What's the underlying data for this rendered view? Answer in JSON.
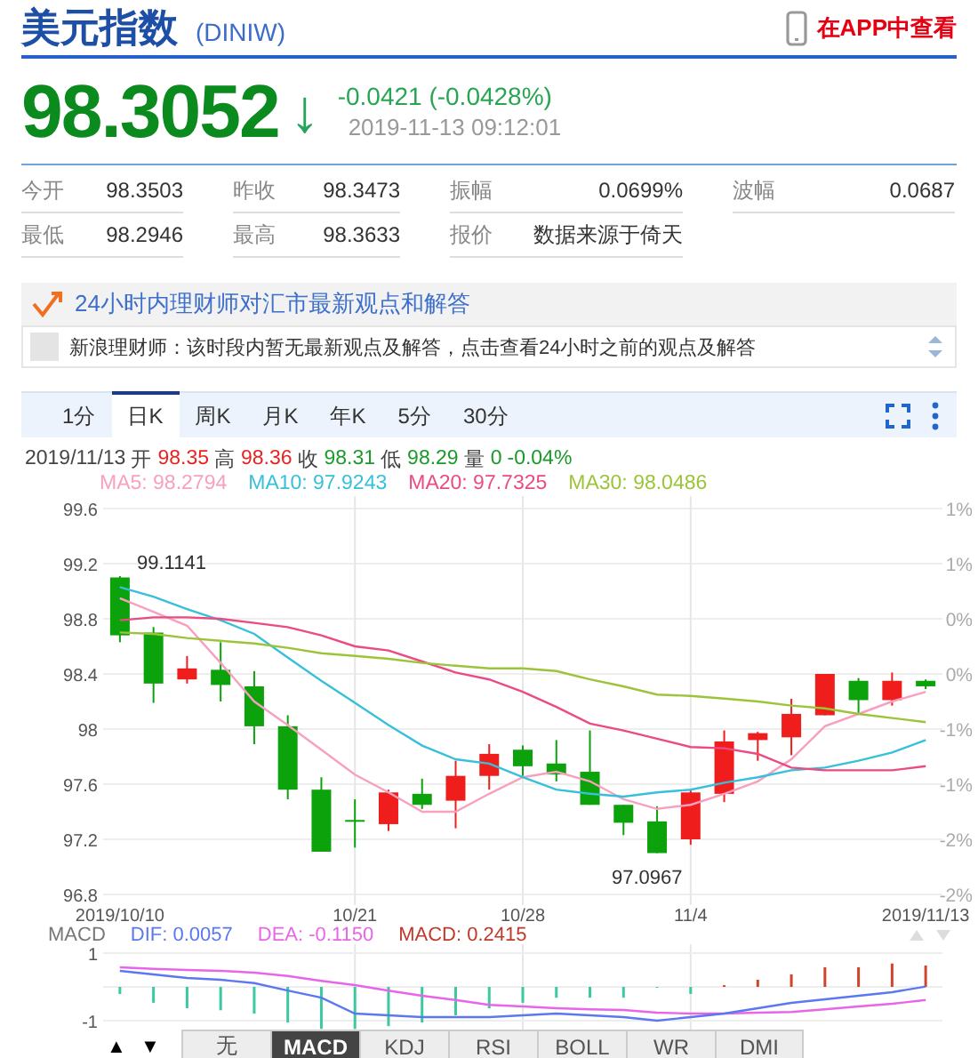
{
  "header": {
    "title": "美元指数",
    "code": "(DINIW)",
    "app_link": "在APP中查看"
  },
  "quote": {
    "price": "98.3052",
    "arrow": "↓",
    "change": "-0.0421 (-0.0428%)",
    "time": "2019-11-13 09:12:01"
  },
  "stats": [
    [
      {
        "label": "今开",
        "value": "98.3503"
      },
      {
        "label": "昨收",
        "value": "98.3473"
      },
      {
        "label": "振幅",
        "value": "0.0699%"
      },
      {
        "label": "波幅",
        "value": "0.0687"
      }
    ],
    [
      {
        "label": "最低",
        "value": "98.2946"
      },
      {
        "label": "最高",
        "value": "98.3633"
      },
      {
        "label": "报价",
        "value": "数据来源于倚天"
      }
    ]
  ],
  "expert": {
    "title": "24小时内理财师对汇市最新观点和解答",
    "message": "新浪理财师：该时段内暂无最新观点及解答，点击查看24小时之前的观点及解答"
  },
  "period_tabs": [
    {
      "label": "1分",
      "selected": false
    },
    {
      "label": "日K",
      "selected": true
    },
    {
      "label": "周K",
      "selected": false
    },
    {
      "label": "月K",
      "selected": false
    },
    {
      "label": "年K",
      "selected": false
    },
    {
      "label": "5分",
      "selected": false
    },
    {
      "label": "30分",
      "selected": false
    }
  ],
  "kline": {
    "date": "2019/11/13",
    "fields": [
      {
        "label": "开",
        "value": "98.35",
        "color": "#e8231f"
      },
      {
        "label": "高",
        "value": "98.36",
        "color": "#e8231f"
      },
      {
        "label": "收",
        "value": "98.31",
        "color": "#1a9a2a"
      },
      {
        "label": "低",
        "value": "98.29",
        "color": "#1a9a2a"
      },
      {
        "label": "量",
        "value": "0",
        "color": "#1a9a2a"
      }
    ],
    "change": "-0.04%",
    "pct_labels": [
      "1%",
      "1%",
      "0%",
      "0%",
      "-1%",
      "-1%",
      "-2%",
      "-2%"
    ],
    "high_mark": "99.1141",
    "low_mark": "97.0967",
    "chart_data": {
      "type": "candlestick",
      "grid": true,
      "categories": [
        "2019/10/10",
        null,
        null,
        null,
        null,
        null,
        null,
        "10/21",
        null,
        null,
        null,
        null,
        "10/28",
        null,
        null,
        null,
        null,
        "11/4",
        null,
        null,
        null,
        null,
        null,
        null,
        "2019/11/13"
      ],
      "ylim": [
        96.8,
        99.6
      ],
      "yticks": [
        {
          "value": 99.6,
          "label": "99.6"
        },
        {
          "value": 99.2,
          "label": "99.2"
        },
        {
          "value": 98.8,
          "label": "98.8"
        },
        {
          "value": 98.4,
          "label": "98.4"
        },
        {
          "value": 98,
          "label": "98"
        },
        {
          "value": 97.6,
          "label": "97.6"
        },
        {
          "value": 97.2,
          "label": "97.2"
        },
        {
          "value": 96.8,
          "label": "96.8"
        }
      ],
      "ohlc": [
        [
          99.1,
          99.11,
          98.63,
          98.68
        ],
        [
          98.7,
          98.74,
          98.19,
          98.33
        ],
        [
          98.36,
          98.53,
          98.33,
          98.44
        ],
        [
          98.43,
          98.63,
          98.2,
          98.32
        ],
        [
          98.31,
          98.42,
          97.89,
          98.02
        ],
        [
          98.02,
          98.1,
          97.49,
          97.56
        ],
        [
          97.56,
          97.65,
          97.11,
          97.11
        ],
        [
          97.34,
          97.49,
          97.14,
          97.33
        ],
        [
          97.31,
          97.56,
          97.26,
          97.54
        ],
        [
          97.53,
          97.64,
          97.42,
          97.45
        ],
        [
          97.48,
          97.77,
          97.28,
          97.66
        ],
        [
          97.66,
          97.89,
          97.56,
          97.82
        ],
        [
          97.85,
          97.88,
          97.66,
          97.73
        ],
        [
          97.75,
          97.92,
          97.62,
          97.67
        ],
        [
          97.69,
          97.99,
          97.45,
          97.45
        ],
        [
          97.45,
          97.45,
          97.23,
          97.32
        ],
        [
          97.33,
          97.44,
          97.1,
          97.1
        ],
        [
          97.2,
          97.56,
          97.16,
          97.54
        ],
        [
          97.53,
          97.99,
          97.47,
          97.91
        ],
        [
          97.92,
          97.98,
          97.77,
          97.97
        ],
        [
          97.94,
          98.22,
          97.81,
          98.11
        ],
        [
          98.1,
          98.4,
          98.1,
          98.4
        ],
        [
          98.35,
          98.37,
          98.11,
          98.21
        ],
        [
          98.21,
          98.41,
          98.17,
          98.35
        ],
        [
          98.35,
          98.36,
          98.29,
          98.31
        ]
      ],
      "series": [
        {
          "name": "MA5: 98.2794",
          "color": "#f7a0bf",
          "type": "line",
          "values": [
            98.95,
            98.85,
            98.75,
            98.48,
            98.2,
            98.03,
            97.85,
            97.67,
            97.54,
            97.4,
            97.4,
            97.53,
            97.65,
            97.69,
            97.62,
            97.49,
            97.42,
            97.45,
            97.53,
            97.62,
            97.78,
            98.02,
            98.11,
            98.2,
            98.27
          ]
        },
        {
          "name": "MA10: 97.9243",
          "color": "#36c0da",
          "type": "line",
          "values": [
            99.03,
            98.96,
            98.87,
            98.79,
            98.69,
            98.52,
            98.35,
            98.19,
            98.03,
            97.88,
            97.78,
            97.75,
            97.65,
            97.56,
            97.53,
            97.51,
            97.54,
            97.56,
            97.61,
            97.65,
            97.7,
            97.72,
            97.77,
            97.83,
            97.92
          ]
        },
        {
          "name": "MA20: 97.7325",
          "color": "#ec4a82",
          "type": "line",
          "values": [
            98.79,
            98.81,
            98.81,
            98.8,
            98.77,
            98.74,
            98.68,
            98.6,
            98.57,
            98.49,
            98.41,
            98.36,
            98.27,
            98.16,
            98.04,
            97.99,
            97.93,
            97.87,
            97.86,
            97.82,
            97.72,
            97.7,
            97.7,
            97.7,
            97.73
          ]
        },
        {
          "name": "MA30: 98.0486",
          "color": "#9cc43a",
          "type": "line",
          "values": [
            98.7,
            98.69,
            98.66,
            98.64,
            98.62,
            98.59,
            98.55,
            98.53,
            98.51,
            98.48,
            98.46,
            98.44,
            98.44,
            98.42,
            98.36,
            98.31,
            98.25,
            98.24,
            98.22,
            98.2,
            98.17,
            98.15,
            98.11,
            98.08,
            98.05
          ]
        }
      ]
    }
  },
  "macd": {
    "name": "MACD",
    "chart_data": {
      "type": "bar",
      "grid": true,
      "ylim": [
        -1.26,
        1.26
      ],
      "yticks": [
        {
          "value": 1,
          "label": "1"
        },
        {
          "value": -1,
          "label": "-1"
        }
      ],
      "series": [
        {
          "name": "DIF: 0.0057",
          "color": "#5b78f0",
          "type": "line",
          "values": [
            0.47,
            0.37,
            0.26,
            0.21,
            0.11,
            -0.11,
            -0.32,
            -0.79,
            -0.84,
            -0.89,
            -0.89,
            -0.89,
            -0.84,
            -0.79,
            -0.84,
            -0.89,
            -1.0,
            -0.89,
            -0.79,
            -0.63,
            -0.47,
            -0.37,
            -0.26,
            -0.16,
            0.01
          ]
        },
        {
          "name": "DEA: -0.1150",
          "color": "#e865e8",
          "type": "line",
          "values": [
            0.58,
            0.53,
            0.5,
            0.47,
            0.42,
            0.32,
            0.18,
            0.05,
            -0.11,
            -0.26,
            -0.39,
            -0.53,
            -0.58,
            -0.63,
            -0.66,
            -0.68,
            -0.76,
            -0.79,
            -0.79,
            -0.76,
            -0.74,
            -0.66,
            -0.58,
            -0.5,
            -0.39
          ]
        },
        {
          "name": "MACD: 0.2415",
          "color": "#c0392b",
          "type": "bar",
          "colors": [
            "#3cc8a0",
            "#3cc8a0",
            "#3cc8a0",
            "#3cc8a0",
            "#3cc8a0",
            "#3cc8a0",
            "#3cc8a0",
            "#3cc8a0",
            "#3cc8a0",
            "#3cc8a0",
            "#3cc8a0",
            "#3cc8a0",
            "#3cc8a0",
            "#3cc8a0",
            "#3cc8a0",
            "#3cc8a0",
            "#3cc8a0",
            "#3cc8a0",
            "#d0442c",
            "#d0442c",
            "#d0442c",
            "#d0442c",
            "#d0442c",
            "#d0442c",
            "#d0442c"
          ],
          "values": [
            -0.21,
            -0.47,
            -0.63,
            -0.69,
            -0.79,
            -1.05,
            -1.24,
            -1.24,
            -1.16,
            -1.05,
            -0.84,
            -0.63,
            -0.47,
            -0.32,
            -0.32,
            -0.32,
            0,
            -0.21,
            0.05,
            0.21,
            0.37,
            0.58,
            0.58,
            0.69,
            0.63
          ]
        }
      ]
    }
  },
  "indicator_nav": [
    "▲",
    "▼"
  ],
  "indicator_tabs": [
    {
      "label": "无",
      "selected": false
    },
    {
      "label": "MACD",
      "selected": true
    },
    {
      "label": "KDJ",
      "selected": false
    },
    {
      "label": "RSI",
      "selected": false
    },
    {
      "label": "BOLL",
      "selected": false
    },
    {
      "label": "WR",
      "selected": false
    },
    {
      "label": "DMI",
      "selected": false
    }
  ]
}
